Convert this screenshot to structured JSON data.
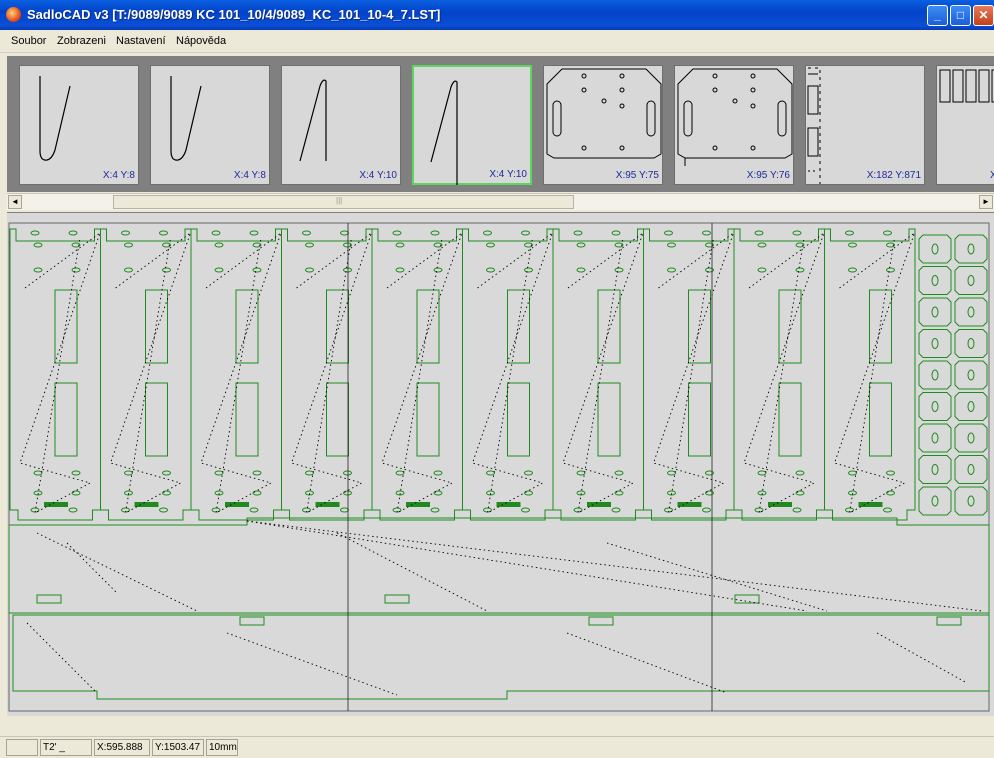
{
  "window": {
    "title": "SadloCAD v3  [T:/9089/9089 KC 101_10/4/9089_KC_101_10-4_7.LST]",
    "minimize_glyph": "_",
    "maximize_glyph": "□",
    "close_glyph": "✕"
  },
  "menu": [
    "Soubor",
    "Zobrazeni",
    "Nastavení",
    "Nápověda"
  ],
  "thumbnails": [
    {
      "coord": "X:4 Y:8"
    },
    {
      "coord": "X:4 Y:8"
    },
    {
      "coord": "X:4 Y:10"
    },
    {
      "coord": "X:4 Y:10",
      "selected": true
    },
    {
      "coord": "X:95 Y:75"
    },
    {
      "coord": "X:95 Y:76"
    },
    {
      "coord": "X:182 Y:871"
    },
    {
      "coord": "X"
    }
  ],
  "scrollbar": {
    "left_arrow": "◄",
    "right_arrow": "►",
    "grip": "|||"
  },
  "status": {
    "panel1": "",
    "panel2": "T2'  _",
    "x": "X:595.888",
    "y": "Y:1503.47",
    "unit": "10mm"
  },
  "colors": {
    "titlebar": "#0a4fd6",
    "canvas_bg": "#d9d9d9",
    "part_outline": "#1f8a1f",
    "toolpath": "#000000",
    "thumb_coord": "#1a2a9a",
    "selected_thumb_border": "#5cd65c"
  }
}
